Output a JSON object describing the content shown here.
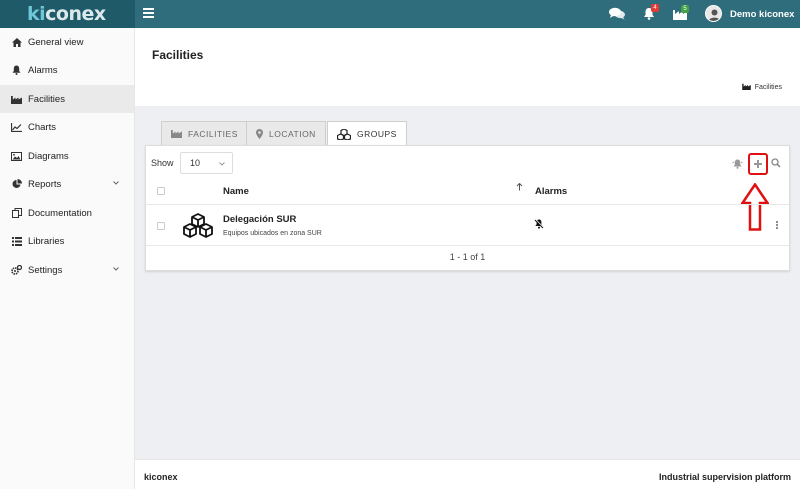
{
  "app": {
    "logo_text_ki": "ki",
    "logo_text_rest": "conex",
    "user_name": "Demo kiconex"
  },
  "topbar": {
    "notifications_count": "4",
    "facilities_count": "5",
    "colors": {
      "bar": "#2f6d7d",
      "logo_bg": "#1f5a69",
      "badge_red": "#e53935",
      "badge_green": "#43a047"
    }
  },
  "sidebar": {
    "items": [
      {
        "label": "General view",
        "icon": "home-icon"
      },
      {
        "label": "Alarms",
        "icon": "bell-icon"
      },
      {
        "label": "Facilities",
        "icon": "factory-icon",
        "active": true
      },
      {
        "label": "Charts",
        "icon": "line-chart-icon"
      },
      {
        "label": "Diagrams",
        "icon": "image-icon"
      },
      {
        "label": "Reports",
        "icon": "pie-chart-icon",
        "expandable": true
      },
      {
        "label": "Documentation",
        "icon": "copy-icon"
      },
      {
        "label": "Libraries",
        "icon": "list-icon"
      },
      {
        "label": "Settings",
        "icon": "cogs-icon",
        "expandable": true
      }
    ]
  },
  "header": {
    "title": "Facilities",
    "breadcrumb": "Facilities"
  },
  "tabs": [
    {
      "label": "FACILITIES",
      "icon": "factory-icon"
    },
    {
      "label": "LOCATION",
      "icon": "map-marker-icon"
    },
    {
      "label": "GROUPS",
      "icon": "cubes-icon",
      "active": true
    }
  ],
  "table": {
    "show_label": "Show",
    "page_size": "10",
    "columns": {
      "name": "Name",
      "alarms": "Alarms"
    },
    "rows": [
      {
        "name": "Delegación SUR",
        "description": "Equipos ubicados en zona SUR"
      }
    ],
    "pagination": "1 - 1 of 1"
  },
  "annotation": {
    "color": "#e01010"
  },
  "footer": {
    "left": "kiconex",
    "right": "Industrial supervision platform"
  }
}
